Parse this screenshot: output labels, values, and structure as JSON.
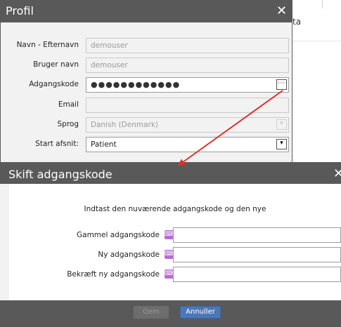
{
  "background": {
    "partial_text": "ta"
  },
  "profil": {
    "title": "Profil",
    "close_glyph": "✕",
    "fields": [
      {
        "label": "Navn - Efternavn",
        "value": "demouser"
      },
      {
        "label": "Bruger navn",
        "value": "demouser"
      },
      {
        "label": "Adgangskode",
        "value": "●●●●●●●●●●●●",
        "button": "···"
      },
      {
        "label": "Email",
        "value": ""
      },
      {
        "label": "Sprog",
        "value": "Danish (Denmark)",
        "button": "▾"
      },
      {
        "label": "Start afsnit:",
        "value": "Patient",
        "button": "▾"
      }
    ]
  },
  "skift": {
    "title": "Skift adgangskode",
    "close_glyph": "✕",
    "message": "Indtast den nuværende adgangskode og den nye",
    "keyboard_glyph": "⌨",
    "rows": [
      {
        "label": "Gammel adgangskode",
        "value": ""
      },
      {
        "label": "Ny adgangskode",
        "value": ""
      },
      {
        "label": "Bekræft ny adgangskode",
        "value": ""
      }
    ],
    "buttons": {
      "save": "Gem",
      "cancel": "Annuller"
    }
  },
  "colors": {
    "titlebar": "#595959",
    "dialog_bg": "#f2f2f2",
    "arrow": "#e0302a",
    "keyboard_icon": "#b96bd6",
    "primary_button": "#4a77b8"
  }
}
